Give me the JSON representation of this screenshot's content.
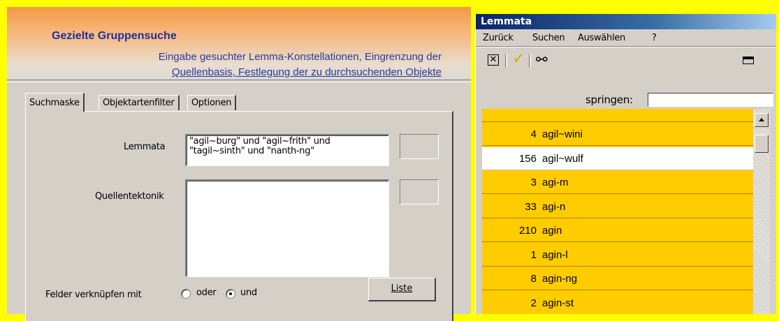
{
  "left_panel": {
    "title": "Gezielte Gruppensuche",
    "description_line1": "Eingabe gesuchter Lemma-Konstellationen, Eingrenzung der",
    "description_line2": "Quellenbasis, Festlegung der zu durchsuchenden Objekte",
    "tabs": [
      {
        "label": "Suchmaske",
        "active": true
      },
      {
        "label": "Objektartenfilter",
        "active": false
      },
      {
        "label": "Optionen",
        "active": false
      }
    ],
    "lemmata_label": "Lemmata",
    "lemmata_value_line1": "\"agil~burg\" und \"agil~frith\" und",
    "lemmata_value_line2": "\"tagil~sinth\" und \"nanth-ng\"",
    "quellentektonik_label": "Quellentektonik",
    "quellentektonik_value": "",
    "felder_label": "Felder verknüpfen mit",
    "radio_oder_label": "oder",
    "radio_und_label": "und",
    "selected_link": "und",
    "liste_button_label": "Liste"
  },
  "right_window": {
    "title": "Lemmata",
    "menu": [
      "Zurück",
      "Suchen",
      "Auswählen",
      "?"
    ],
    "springen_label": "springen:",
    "springen_value": "",
    "list_items": [
      {
        "count": "4",
        "lemma": "agil~wini",
        "selected": false
      },
      {
        "count": "156",
        "lemma": "agil~wulf",
        "selected": true
      },
      {
        "count": "3",
        "lemma": "agi-m",
        "selected": false
      },
      {
        "count": "33",
        "lemma": "agi-n",
        "selected": false
      },
      {
        "count": "210",
        "lemma": "agin",
        "selected": false
      },
      {
        "count": "1",
        "lemma": "agin-l",
        "selected": false
      },
      {
        "count": "8",
        "lemma": "agin-ng",
        "selected": false
      },
      {
        "count": "2",
        "lemma": "agin-st",
        "selected": false
      }
    ],
    "colors": {
      "list_bg": "#ffcc00",
      "selected_bg": "#ffffff",
      "title_bar": "#0a246a"
    }
  }
}
